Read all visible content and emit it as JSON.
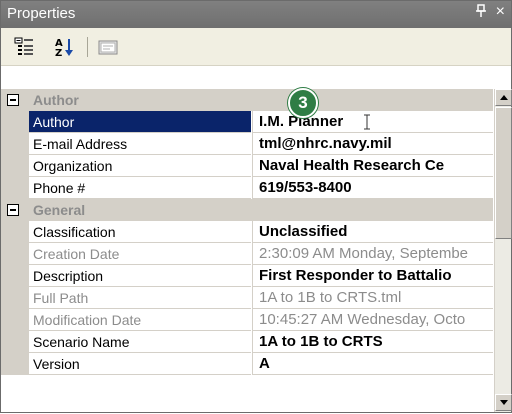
{
  "title": "Properties",
  "title_controls": {
    "pin": "ᵖ",
    "close": "×"
  },
  "toolbar": {
    "categorized_icon": "categorized-icon",
    "alphabetical_icon": "sort-alpha-icon",
    "property_pages_icon": "property-pages-icon"
  },
  "badge": "3",
  "rows": [
    {
      "type": "category",
      "label": "Author"
    },
    {
      "type": "prop",
      "name": "Author",
      "value": "I.M. Planner",
      "bold": true,
      "disabled": false,
      "selected": true
    },
    {
      "type": "prop",
      "name": "E-mail Address",
      "value": "tml@nhrc.navy.mil",
      "bold": true,
      "disabled": false
    },
    {
      "type": "prop",
      "name": "Organization",
      "value": "Naval Health Research Ce",
      "bold": true,
      "disabled": false
    },
    {
      "type": "prop",
      "name": "Phone #",
      "value": "619/553-8400",
      "bold": true,
      "disabled": false
    },
    {
      "type": "category",
      "label": "General"
    },
    {
      "type": "prop",
      "name": "Classification",
      "value": "Unclassified",
      "bold": true,
      "disabled": false
    },
    {
      "type": "prop",
      "name": "Creation Date",
      "value": "2:30:09 AM Monday, Septembe",
      "bold": false,
      "disabled": true
    },
    {
      "type": "prop",
      "name": "Description",
      "value": "First Responder to Battalio",
      "bold": true,
      "disabled": false
    },
    {
      "type": "prop",
      "name": "Full Path",
      "value": "1A to 1B to CRTS.tml",
      "bold": false,
      "disabled": true
    },
    {
      "type": "prop",
      "name": "Modification Date",
      "value": "10:45:27 AM Wednesday, Octo",
      "bold": false,
      "disabled": true
    },
    {
      "type": "prop",
      "name": "Scenario Name",
      "value": "1A to 1B to CRTS",
      "bold": true,
      "disabled": false
    },
    {
      "type": "prop",
      "name": "Version",
      "value": "A",
      "bold": true,
      "disabled": false
    }
  ],
  "colors": {
    "titlebar": "#7a7a7a",
    "selection": "#0a246a",
    "badge": "#2f7d45",
    "category_bg": "#d4d0c8"
  }
}
